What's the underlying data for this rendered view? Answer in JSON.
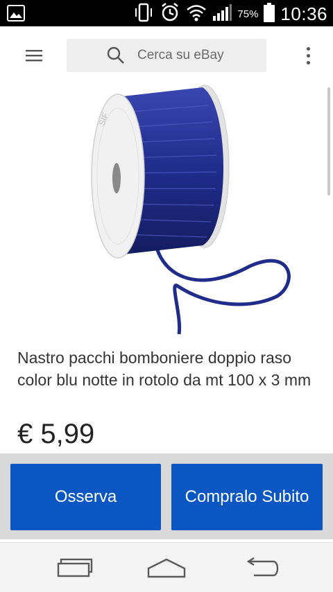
{
  "status_bar": {
    "battery_percent": "75%",
    "time": "10:36",
    "icons": [
      "gallery-icon",
      "vibrate-icon",
      "alarm-icon",
      "wifi-icon",
      "signal-icon",
      "battery-icon"
    ]
  },
  "header": {
    "search_placeholder": "Cerca su eBay",
    "menu_icon": "hamburger-menu-icon",
    "overflow_icon": "more-vert-icon"
  },
  "product": {
    "title": "Nastro pacchi bomboniere doppio raso color blu notte in rotolo da mt 100 x 3 mm",
    "price": "€ 5,99",
    "ribbon_color": "#1f2c8a"
  },
  "actions": {
    "watch_label": "Osserva",
    "buy_label": "Compralo Subito",
    "button_color": "#0a56c2"
  },
  "nav": {
    "icons": [
      "recent-apps-icon",
      "home-icon",
      "back-icon"
    ]
  }
}
